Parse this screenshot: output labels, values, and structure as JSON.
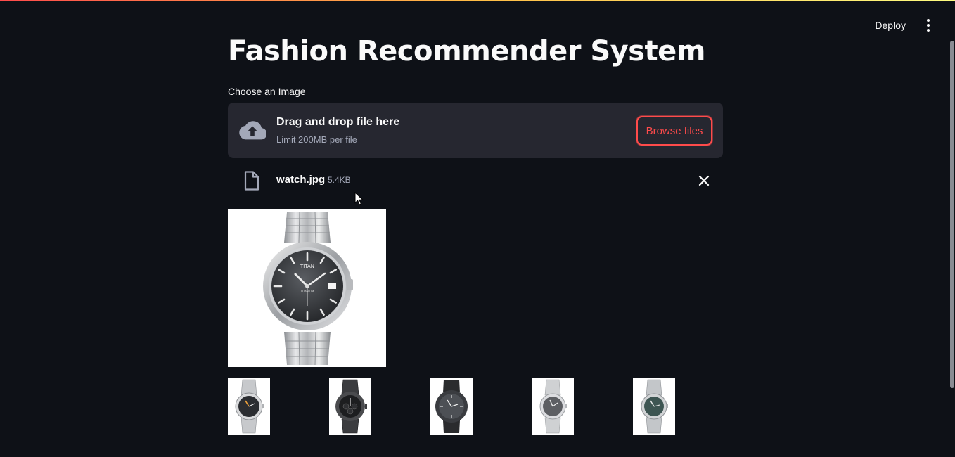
{
  "header": {
    "deploy_label": "Deploy",
    "menu_icon": "kebab-menu-icon"
  },
  "page": {
    "title": "Fashion Recommender System"
  },
  "uploader": {
    "label": "Choose an Image",
    "drag_text": "Drag and drop file here",
    "limit_text": "Limit 200MB per file",
    "browse_label": "Browse files",
    "icon": "cloud-upload-icon"
  },
  "uploaded_file": {
    "name": "watch.jpg",
    "size": "5.4KB",
    "icon": "file-icon",
    "remove_icon": "close-icon"
  },
  "preview": {
    "brand_text": "TITAN",
    "dial_text": "TITANIUM"
  },
  "recommendations": [
    {
      "icon": "watch-silver-black-dial-icon"
    },
    {
      "icon": "watch-black-chronograph-icon"
    },
    {
      "icon": "watch-black-leather-icon"
    },
    {
      "icon": "watch-silver-grey-dial-icon"
    },
    {
      "icon": "watch-silver-green-dial-icon"
    }
  ],
  "colors": {
    "background": "#0e1117",
    "panel": "#262730",
    "accent": "#ff4b4b",
    "text": "#fafafa",
    "muted": "#a3a8b8"
  }
}
